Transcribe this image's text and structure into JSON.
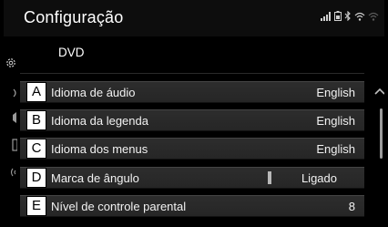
{
  "header": {
    "title": "Configuração"
  },
  "section": {
    "title": "DVD"
  },
  "rows": [
    {
      "tag": "A",
      "label": "Idioma de áudio",
      "value": "English"
    },
    {
      "tag": "B",
      "label": "Idioma da legenda",
      "value": "English"
    },
    {
      "tag": "C",
      "label": "Idioma dos menus",
      "value": "English"
    },
    {
      "tag": "D",
      "label": "Marca de ângulo",
      "value": "Ligado"
    },
    {
      "tag": "E",
      "label": "Nível de controle parental",
      "value": "8"
    }
  ],
  "icons": {
    "status": [
      "signal-icon",
      "battery-icon",
      "bluetooth-icon",
      "wifi-icon",
      "wifi-weak-icon"
    ],
    "left_rail": [
      "settings-gear-icon",
      "bluetooth-icon",
      "speaker-icon",
      "phone-icon",
      "antenna-icon"
    ],
    "scroll": "chevron-up-icon"
  },
  "colors": {
    "background": "#000000",
    "row": "#2a2a2a",
    "text": "#ffffff",
    "tag_bg": "#ffffff"
  }
}
